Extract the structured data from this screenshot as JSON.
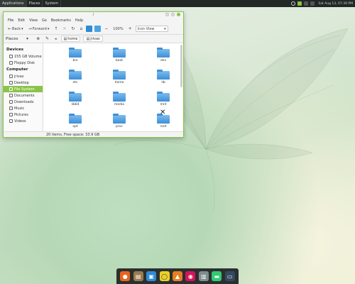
{
  "panel": {
    "tasks": [
      "Applications",
      "Places",
      "System"
    ],
    "clock": "Sat Aug 13, 07:39 PM"
  },
  "window": {
    "title": "/",
    "menu": [
      "File",
      "Edit",
      "View",
      "Go",
      "Bookmarks",
      "Help"
    ],
    "toolbar": {
      "back": "Back",
      "forward": "Forward",
      "zoom": "100%",
      "view_mode": "Icon View"
    },
    "places_label": "Places",
    "breadcrumbs": [
      "home",
      "jrivas"
    ],
    "sidebar": {
      "devices_header": "Devices",
      "devices": [
        "155 GB Volume",
        "Floppy Disk"
      ],
      "computer_header": "Computer",
      "computer": [
        "jrivas",
        "Desktop",
        "File System",
        "Documents",
        "Downloads",
        "Music",
        "Pictures",
        "Videos"
      ],
      "selected": "File System"
    },
    "folders": [
      "bin",
      "boot",
      "dev",
      "etc",
      "home",
      "lib",
      "lib64",
      "media",
      "mnt",
      "opt",
      "proc",
      "root"
    ],
    "status": "20 items, Free space: 33.9 GB"
  },
  "colors": {
    "accent": "#8bc34a",
    "folder": "#3e8fd6",
    "panel": "#222826"
  }
}
